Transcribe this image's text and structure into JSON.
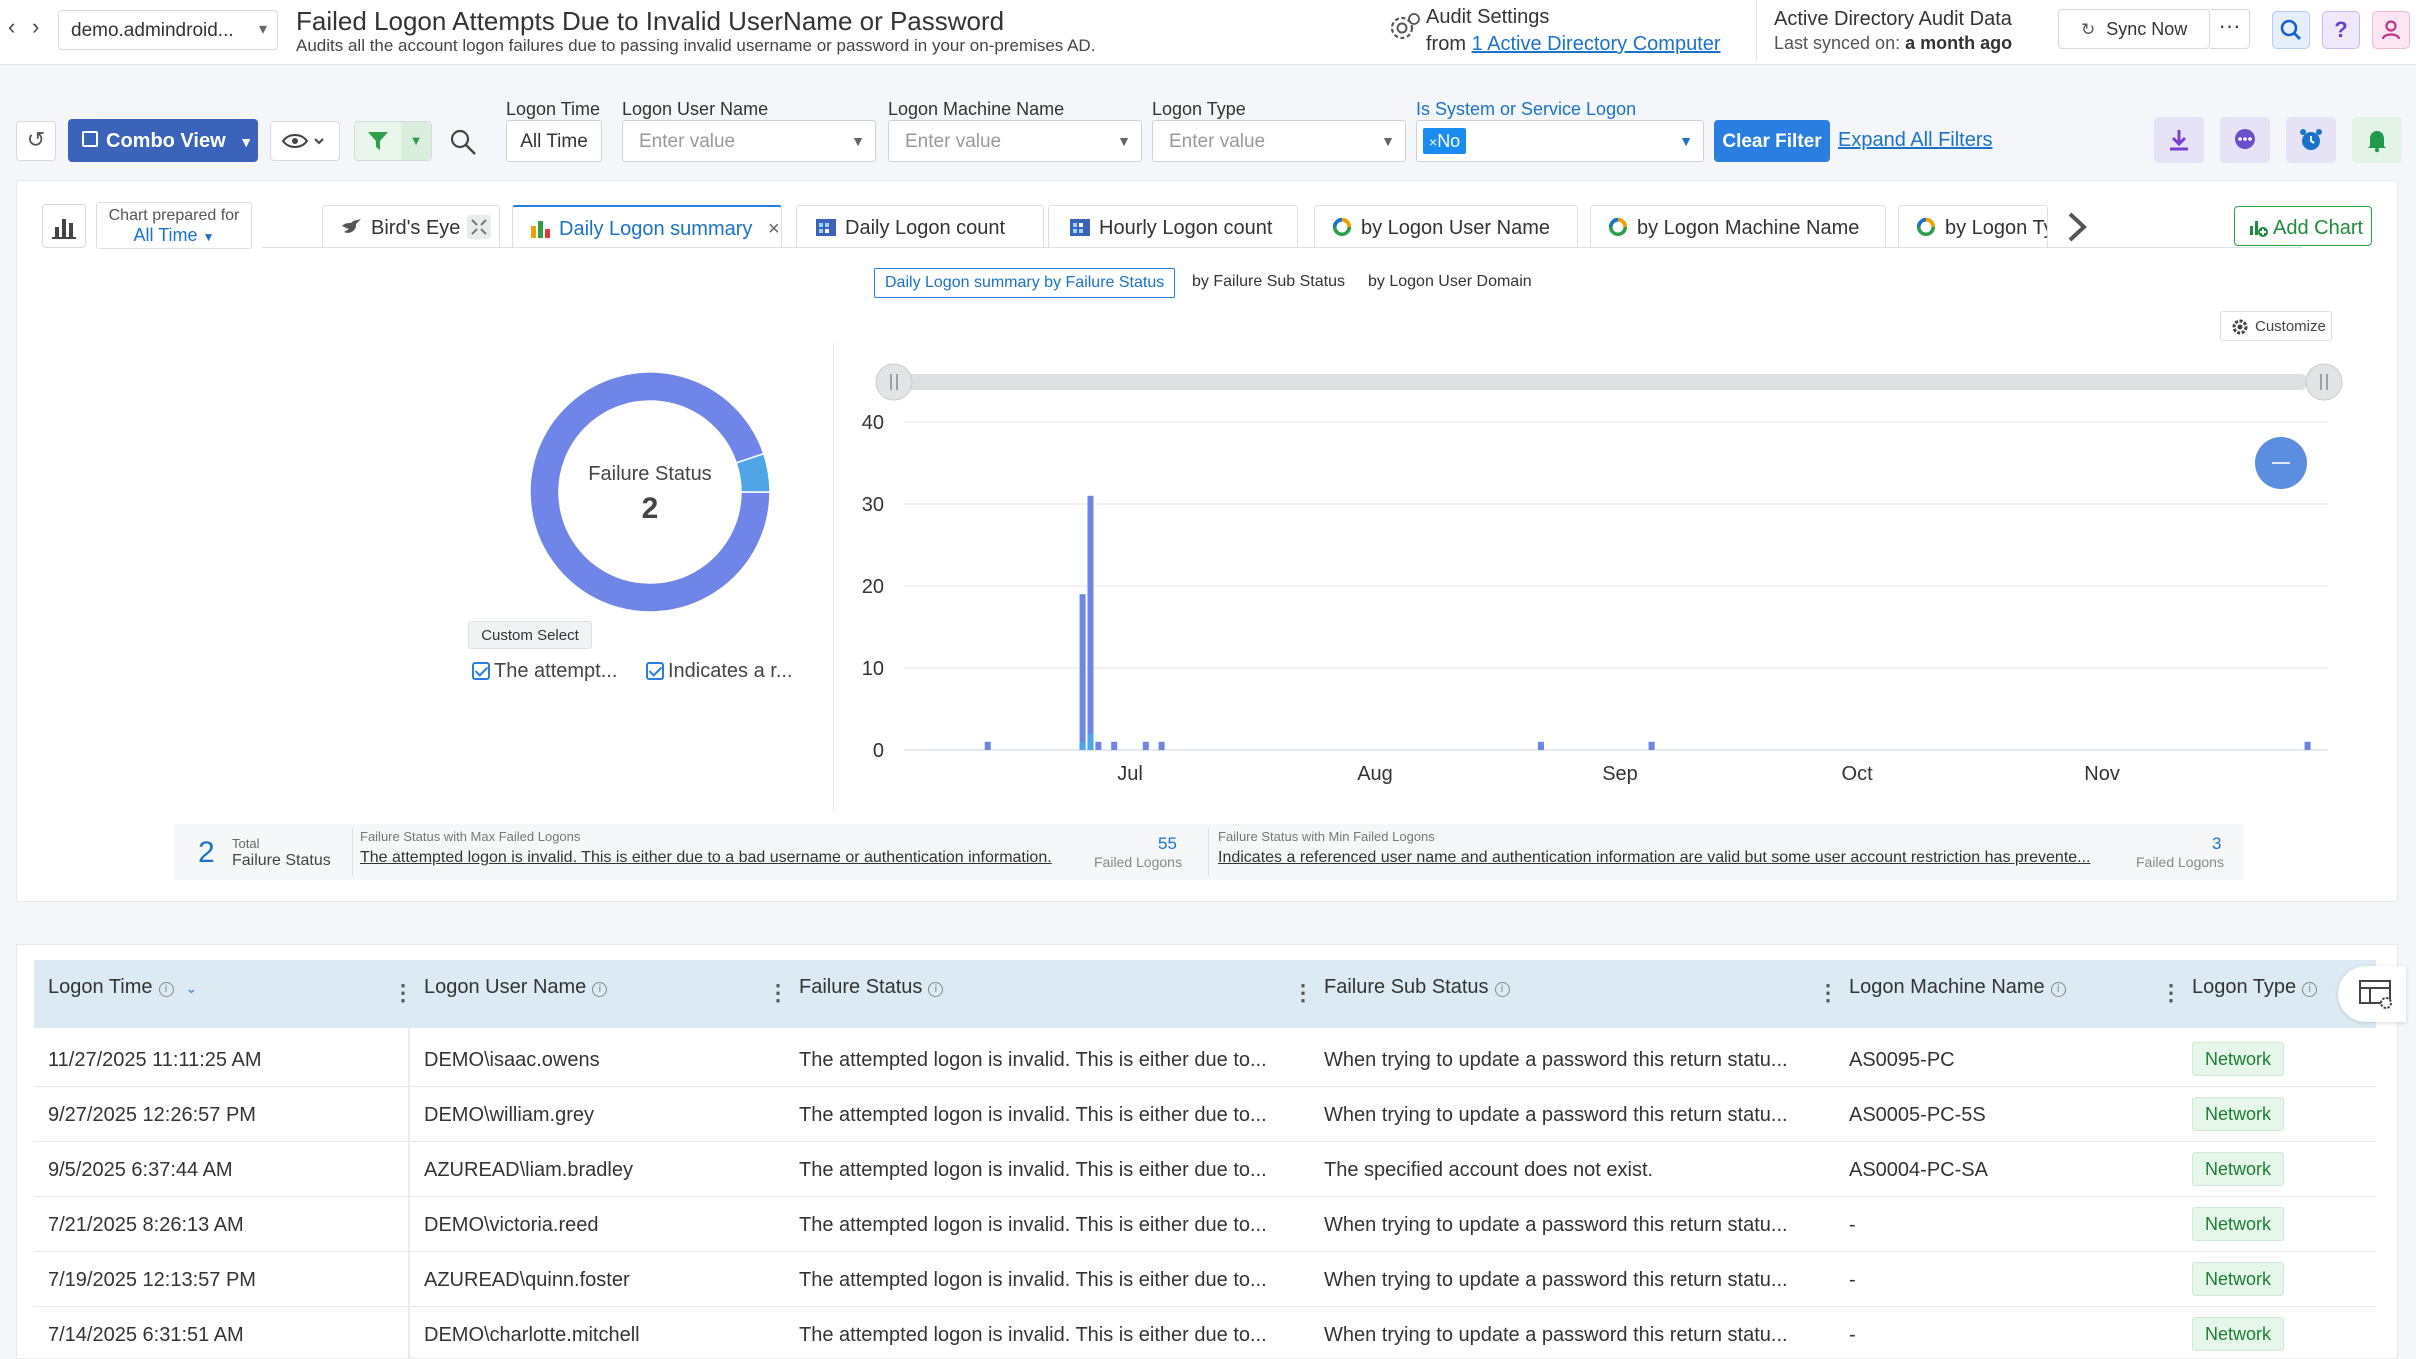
{
  "header": {
    "tenant": "demo.admindroid...",
    "title": "Failed Logon Attempts Due to Invalid UserName or Password",
    "description": "Audits all the account logon failures due to passing invalid username or password in your on-premises AD.",
    "audit_settings_title": "Audit Settings",
    "audit_from_prefix": "from",
    "audit_from_link": "1 Active Directory Computer",
    "ad_title": "Active Directory Audit Data",
    "ad_sync_prefix": "Last synced on:",
    "ad_sync_value": "a month ago",
    "sync_label": "Sync Now",
    "more_label": "···"
  },
  "toolbar": {
    "view_label": "Combo View",
    "filters": {
      "logon_time_label": "Logon Time",
      "logon_time_value": "All Time",
      "user_label": "Logon User Name",
      "user_placeholder": "Enter value",
      "machine_label": "Logon Machine Name",
      "machine_placeholder": "Enter value",
      "type_label": "Logon Type",
      "type_placeholder": "Enter value",
      "system_label": "Is System or Service Logon",
      "system_chip": "No"
    },
    "clear_label": "Clear Filter",
    "expand_label": "Expand All Filters"
  },
  "chart_panel": {
    "prepared_label": "Chart prepared for",
    "prepared_value": "All Time",
    "tabs": [
      {
        "label": "Bird's Eye"
      },
      {
        "label": "Daily Logon summary"
      },
      {
        "label": "Daily Logon count"
      },
      {
        "label": "Hourly Logon count"
      },
      {
        "label": "by Logon User Name"
      },
      {
        "label": "by Logon Machine Name"
      },
      {
        "label": "by Logon Ty"
      }
    ],
    "add_chart_label": "Add Chart",
    "subtabs": [
      "Daily Logon summary by Failure Status",
      "by Failure Sub Status",
      "by Logon User Domain"
    ],
    "customize_label": "Customize",
    "custom_select_label": "Custom Select",
    "legend": [
      "The attempt...",
      "Indicates a r..."
    ]
  },
  "chart_data": [
    {
      "type": "pie",
      "title": "Failure Status",
      "center_value": "2",
      "labels": [
        "The attempted logon is invalid. This is either due to a bad username or authentication information.",
        "Indicates a referenced user name and authentication information are valid but some user account restriction has prevente..."
      ],
      "values": [
        55,
        3
      ],
      "colors": [
        "#6f86e8",
        "#4fa6e6"
      ]
    },
    {
      "type": "bar",
      "x_ticks": [
        "Jul",
        "Aug",
        "Sep",
        "Oct",
        "Nov"
      ],
      "ylim": [
        0,
        40
      ],
      "y_ticks": [
        0,
        10,
        20,
        30,
        40
      ],
      "series": [
        {
          "values": [
            {
              "x": "2025-06-13",
              "y": 1
            },
            {
              "x": "2025-06-25",
              "y": 19
            },
            {
              "x": "2025-06-26",
              "y": 31
            },
            {
              "x": "2025-06-27",
              "y": 1
            },
            {
              "x": "2025-06-29",
              "y": 1
            },
            {
              "x": "2025-07-03",
              "y": 1
            },
            {
              "x": "2025-07-05",
              "y": 1
            },
            {
              "x": "2025-08-22",
              "y": 1
            },
            {
              "x": "2025-09-05",
              "y": 1
            },
            {
              "x": "2025-11-27",
              "y": 1
            }
          ]
        },
        {
          "values": [
            {
              "x": "2025-06-25",
              "y": 1
            },
            {
              "x": "2025-06-26",
              "y": 2
            }
          ]
        }
      ],
      "colors": [
        "#6f86e8",
        "#4fa6e6"
      ],
      "grid": true
    }
  ],
  "summary": {
    "total_value": "2",
    "total_label1": "Total",
    "total_label2": "Failure Status",
    "max_label": "Failure Status with Max Failed Logons",
    "max_text": "The attempted logon is invalid. This is either due to a bad username or authentication information.",
    "max_value": "55",
    "min_label": "Failure Status with Min Failed Logons",
    "min_text": "Indicates a referenced user name and authentication information are valid but some user account restriction has prevente...",
    "min_value": "3",
    "failed_logons_label": "Failed Logons"
  },
  "table": {
    "columns": [
      "Logon Time",
      "Logon User Name",
      "Failure Status",
      "Failure Sub Status",
      "Logon Machine Name",
      "Logon Type"
    ],
    "rows": [
      {
        "time": "11/27/2025 11:11:25 AM",
        "user": "DEMO\\isaac.owens",
        "status": "The attempted logon is invalid. This is either due to...",
        "sub": "When trying to update a password this return statu...",
        "machine": "AS0095-PC",
        "type": "Network"
      },
      {
        "time": "9/27/2025 12:26:57 PM",
        "user": "DEMO\\william.grey",
        "status": "The attempted logon is invalid. This is either due to...",
        "sub": "When trying to update a password this return statu...",
        "machine": "AS0005-PC-5S",
        "type": "Network"
      },
      {
        "time": "9/5/2025 6:37:44 AM",
        "user": "AZUREAD\\liam.bradley",
        "status": "The attempted logon is invalid. This is either due to...",
        "sub": "The specified account does not exist.",
        "machine": "AS0004-PC-SA",
        "type": "Network"
      },
      {
        "time": "7/21/2025 8:26:13 AM",
        "user": "DEMO\\victoria.reed",
        "status": "The attempted logon is invalid. This is either due to...",
        "sub": "When trying to update a password this return statu...",
        "machine": "-",
        "type": "Network"
      },
      {
        "time": "7/19/2025 12:13:57 PM",
        "user": "AZUREAD\\quinn.foster",
        "status": "The attempted logon is invalid. This is either due to...",
        "sub": "When trying to update a password this return statu...",
        "machine": "-",
        "type": "Network"
      },
      {
        "time": "7/14/2025 6:31:51 AM",
        "user": "DEMO\\charlotte.mitchell",
        "status": "The attempted logon is invalid. This is either due to...",
        "sub": "When trying to update a password this return statu...",
        "machine": "-",
        "type": "Network"
      }
    ]
  }
}
